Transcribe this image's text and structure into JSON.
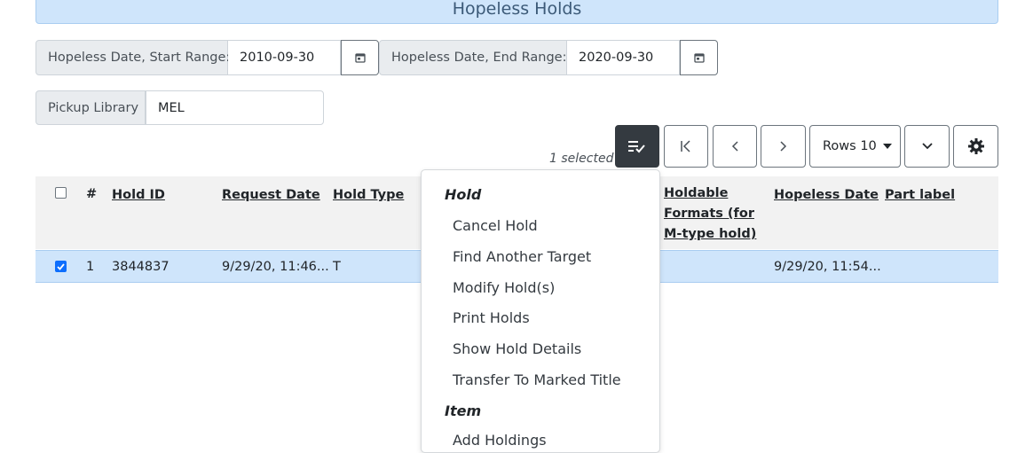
{
  "page": {
    "title": "Hopeless Holds"
  },
  "filters": {
    "start": {
      "label": "Hopeless Date, Start Range:",
      "value": "2010-09-30"
    },
    "end": {
      "label": "Hopeless Date, End Range:",
      "value": "2020-09-30"
    },
    "pickup": {
      "label": "Pickup Library",
      "value": "MEL"
    }
  },
  "toolbar": {
    "selected_text": "1 selected",
    "rows_label": "Rows 10"
  },
  "table": {
    "headers": {
      "num": "#",
      "hold_id": "Hold ID",
      "request_date": "Request Date",
      "hold_type": "Hold Type",
      "formats_1": "Holdable",
      "formats_2": "Formats (for",
      "formats_3": "M-type hold)",
      "hopeless_date": "Hopeless Date",
      "part_label": "Part label"
    },
    "rows": [
      {
        "checked": true,
        "num": "1",
        "hold_id": "3844837",
        "request_date": "9/29/20, 11:46...",
        "hold_type": "T",
        "hopeless_date": "9/29/20, 11:54..."
      }
    ]
  },
  "menu": {
    "hold_header": "Hold",
    "hold_items": [
      "Cancel Hold",
      "Find Another Target",
      "Modify Hold(s)",
      "Print Holds",
      "Show Hold Details",
      "Transfer To Marked Title"
    ],
    "item_header": "Item",
    "item_items": [
      "Add Holdings"
    ]
  },
  "colors": {
    "banner": "#cfe5fb",
    "selected_row": "#cfe5fb",
    "dark_button": "#343a40",
    "checkbox": "#0d6efd"
  },
  "icons": [
    "calendar-icon",
    "select-actions-icon",
    "first-page-icon",
    "previous-page-icon",
    "next-page-icon",
    "caret-down-icon",
    "chevron-down-icon",
    "gear-icon"
  ]
}
